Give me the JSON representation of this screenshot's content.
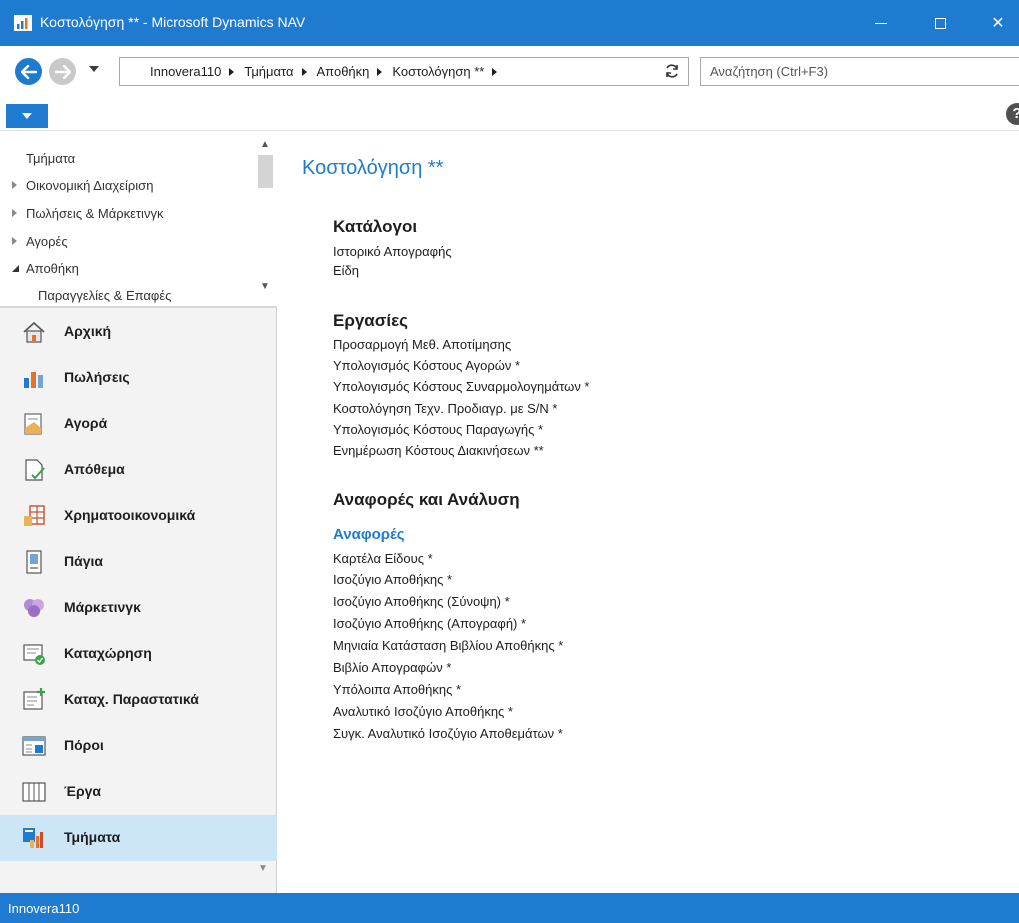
{
  "window": {
    "title": "Κοστολόγηση ** - Microsoft Dynamics NAV",
    "close_glyph": "✕"
  },
  "address": {
    "crumbs": [
      "Innovera110",
      "Τμήματα",
      "Αποθήκη",
      "Κοστολόγηση **"
    ]
  },
  "search": {
    "placeholder": "Αναζήτηση (Ctrl+F3)"
  },
  "help": {
    "label": "?"
  },
  "nav_tree": {
    "items": [
      {
        "label": "Τμήματα",
        "arrow": "none"
      },
      {
        "label": "Οικονομική Διαχείριση",
        "arrow": "collapsed"
      },
      {
        "label": "Πωλήσεις & Μάρκετινγκ",
        "arrow": "collapsed"
      },
      {
        "label": "Αγορές",
        "arrow": "collapsed"
      },
      {
        "label": "Αποθήκη",
        "arrow": "expanded"
      },
      {
        "label": "Παραγγελίες & Επαφές",
        "arrow": "child"
      }
    ]
  },
  "nav_buttons": [
    {
      "label": "Αρχική",
      "icon": "home-icon"
    },
    {
      "label": "Πωλήσεις",
      "icon": "sales-icon"
    },
    {
      "label": "Αγορά",
      "icon": "purchase-icon"
    },
    {
      "label": "Απόθεμα",
      "icon": "inventory-icon"
    },
    {
      "label": "Χρηματοοικονομικά",
      "icon": "finance-icon"
    },
    {
      "label": "Πάγια",
      "icon": "fixed-assets-icon"
    },
    {
      "label": "Μάρκετινγκ",
      "icon": "marketing-icon"
    },
    {
      "label": "Καταχώρηση",
      "icon": "posting-icon"
    },
    {
      "label": "Καταχ. Παραστατικά",
      "icon": "posted-documents-icon"
    },
    {
      "label": "Πόροι",
      "icon": "resources-icon"
    },
    {
      "label": "Έργα",
      "icon": "jobs-icon"
    },
    {
      "label": "Τμήματα",
      "icon": "departments-icon",
      "selected": true
    }
  ],
  "page": {
    "title": "Κοστολόγηση **",
    "sections": {
      "lists": {
        "heading": "Κατάλογοι",
        "links": [
          "Ιστορικό Απογραφής",
          "Είδη"
        ]
      },
      "tasks": {
        "heading": "Εργασίες",
        "links": [
          "Προσαρμογή Μεθ. Αποτίμησης",
          "Υπολογισμός Κόστους Αγορών *",
          "Υπολογισμός Κόστους Συναρμολογημάτων *",
          "Κοστολόγηση Τεχν. Προδιαγρ. με S/N *",
          "Υπολογισμός Κόστους Παραγωγής *",
          "Ενημέρωση Κόστους Διακινήσεων **"
        ]
      },
      "reports_analysis": {
        "heading": "Αναφορές και Ανάλυση",
        "subheading": "Αναφορές",
        "links": [
          "Καρτέλα Είδους *",
          "Ισοζύγιο Αποθήκης *",
          "Ισοζύγιο Αποθήκης (Σύνοψη) *",
          "Ισοζύγιο Αποθήκης (Απογραφή) *",
          "Μηνιαία Κατάσταση Βιβλίου Αποθήκης *",
          "Βιβλίο Απογραφών *",
          "Υπόλοιπα Αποθήκης *",
          "Αναλυτικό Ισοζύγιο Αποθήκης *",
          "Συγκ. Αναλυτικό Ισοζύγιο Αποθεμάτων *"
        ]
      }
    }
  },
  "status": {
    "text": "Innovera110"
  },
  "colors": {
    "accent": "#1f7bd0",
    "selected": "#cde6f7"
  }
}
